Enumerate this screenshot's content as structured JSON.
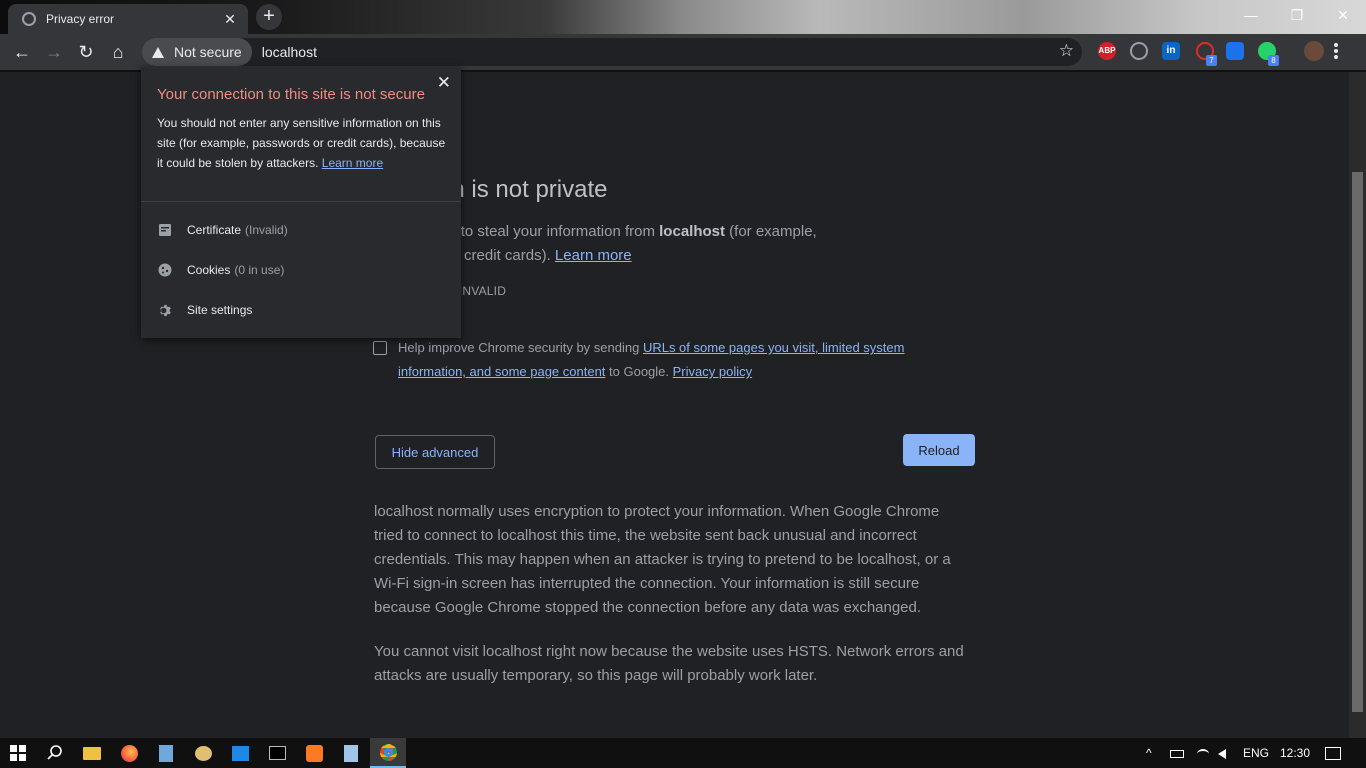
{
  "tab": {
    "title": "Privacy error",
    "close": "✕"
  },
  "newtab": "+",
  "window": {
    "minimize": "—",
    "restore": "❐",
    "close": "✕"
  },
  "toolbar": {
    "back": "←",
    "forward": "→",
    "reload": "↻",
    "home": "⌂"
  },
  "omnibox": {
    "security_label": "Not secure",
    "url": "localhost",
    "bookmark": "☆"
  },
  "extensions": {
    "abp": "ABP",
    "linkedin": "in",
    "badge_g": "7",
    "badge_whatsapp": "8"
  },
  "page": {
    "heading": "nnection is not private",
    "intro_pre": "ght be trying to steal your information from ",
    "intro_host": "localhost",
    "intro_post": " (for example,",
    "intro_line2_pre": "nessages, or credit cards). ",
    "intro_learn_more": "Learn more",
    "error_code": "_AUTHORITY_INVALID",
    "checkbox_text_pre": "Help improve Chrome security by sending ",
    "checkbox_link": "URLs of some pages you visit, limited system information, and some page content",
    "checkbox_text_mid": " to Google. ",
    "checkbox_privacy": "Privacy policy",
    "hide_advanced": "Hide advanced",
    "reload": "Reload",
    "details_1": "localhost normally uses encryption to protect your information. When Google Chrome tried to connect to localhost this time, the website sent back unusual and incorrect credentials. This may happen when an attacker is trying to pretend to be localhost, or a Wi-Fi sign-in screen has interrupted the connection. Your information is still secure because Google Chrome stopped the connection before any data was exchanged.",
    "details_2": "You cannot visit localhost right now because the website uses HSTS. Network errors and attacks are usually temporary, so this page will probably work later."
  },
  "popup": {
    "title": "Your connection to this site is not secure",
    "text": "You should not enter any sensitive information on this site (for example, passwords or credit cards), because it could be stolen by attackers. ",
    "learn_more": "Learn more",
    "close": "✕",
    "certificate_label": "Certificate",
    "certificate_status": "(Invalid)",
    "cookies_label": "Cookies",
    "cookies_status": "(0 in use)",
    "site_settings_label": "Site settings"
  },
  "tray": {
    "chevron": "^",
    "language": "ENG",
    "time": "12:30"
  },
  "colors": {
    "accent": "#8ab4f8",
    "warning_title": "#f28b82",
    "background": "#202124"
  }
}
